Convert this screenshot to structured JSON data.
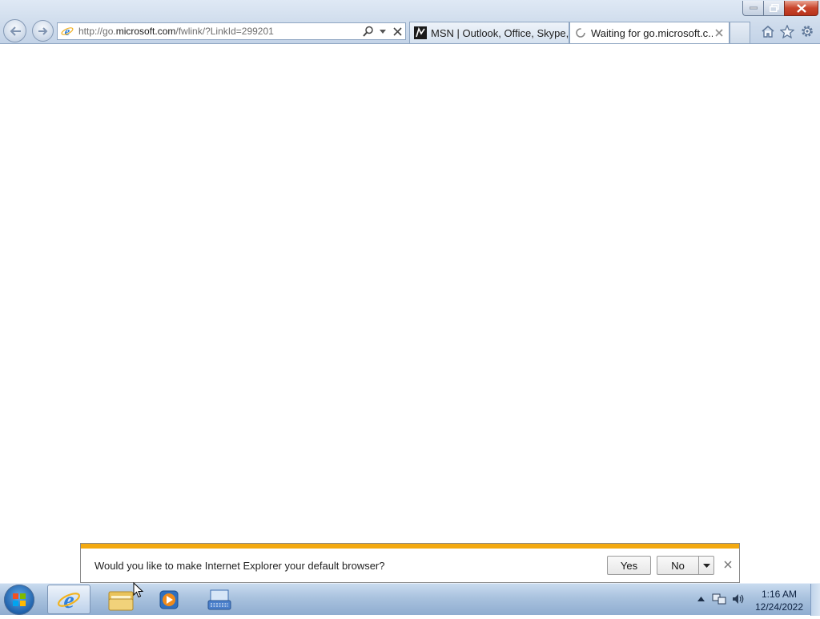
{
  "browser": {
    "address_url_prefix": "http://go.",
    "address_url_domain": "microsoft.com",
    "address_url_path": "/fwlink/?LinkId=299201",
    "tabs": [
      {
        "label": "MSN | Outlook, Office, Skype, ...",
        "icon": "msn-icon"
      },
      {
        "label": "Waiting for go.microsoft.c...",
        "icon": "loading-icon"
      }
    ]
  },
  "notification": {
    "message": "Would you like to make Internet Explorer your default browser?",
    "yes_label": "Yes",
    "no_label": "No"
  },
  "taskbar": {
    "items": [
      "internet-explorer",
      "windows-explorer",
      "windows-media-player",
      "on-screen-keyboard"
    ],
    "time": "1:16 AM",
    "date": "12/24/2022"
  },
  "colors": {
    "notification_stripe": "#f3a910",
    "close_button": "#c8452c",
    "taskbar": "#a9c2de"
  }
}
